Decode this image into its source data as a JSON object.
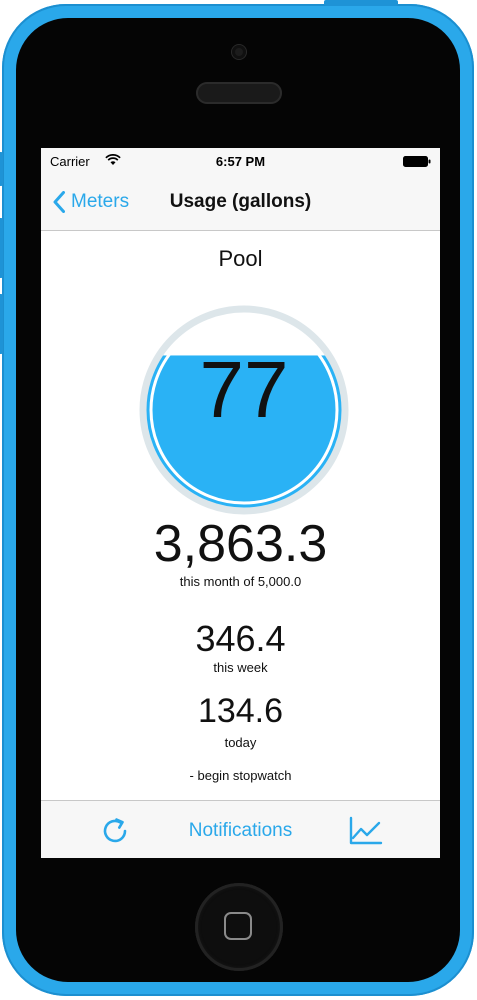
{
  "colors": {
    "accent": "#2aa8ea",
    "phone_body": "#2aa8ea",
    "gauge_fill": "#2ab2f5",
    "gauge_track": "#dde6ea"
  },
  "status_bar": {
    "carrier": "Carrier",
    "time": "6:57 PM",
    "wifi_icon": "wifi-icon",
    "battery_icon": "battery-icon"
  },
  "nav": {
    "back_label": "Meters",
    "back_icon": "chevron-left-icon",
    "title": "Usage (gallons)"
  },
  "meter": {
    "name": "Pool",
    "percent": 77,
    "month_value": "3,863.3",
    "month_label": "this month of 5,000.0",
    "week_value": "346.4",
    "week_label": "this week",
    "today_value": "134.6",
    "today_label": "today",
    "stopwatch_label": "-  begin stopwatch"
  },
  "tab_bar": {
    "refresh_icon": "refresh-icon",
    "notifications_label": "Notifications",
    "chart_icon": "line-chart-icon"
  }
}
